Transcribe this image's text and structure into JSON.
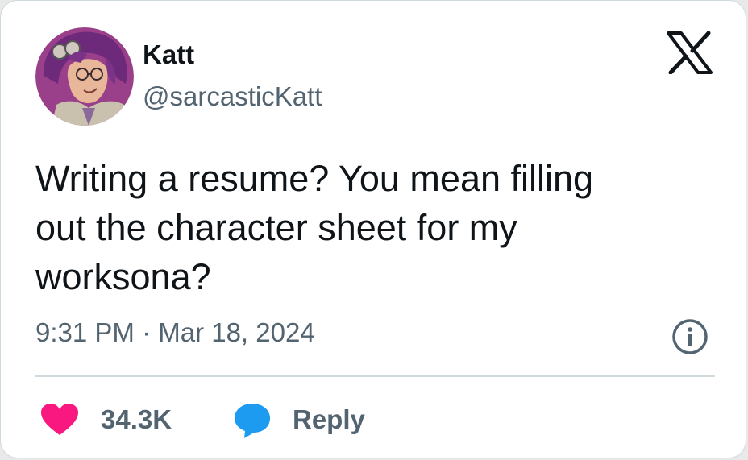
{
  "author": {
    "name": "Katt",
    "handle": "@sarcasticKatt"
  },
  "tweet": {
    "text_lines": [
      "Writing a resume? You mean filling",
      "out the character sheet for my",
      "worksona?"
    ],
    "timestamp": "9:31 PM · Mar 18, 2024"
  },
  "actions": {
    "like_count": "34.3K",
    "reply_label": "Reply"
  },
  "icons": {
    "brand": "x-logo-icon",
    "info": "info-icon",
    "like": "heart-icon",
    "reply": "speech-bubble-icon"
  },
  "colors": {
    "text_primary": "#0f1419",
    "text_secondary": "#536471",
    "like": "#f91880",
    "reply": "#1d9bf0",
    "border": "#cfd9de"
  }
}
